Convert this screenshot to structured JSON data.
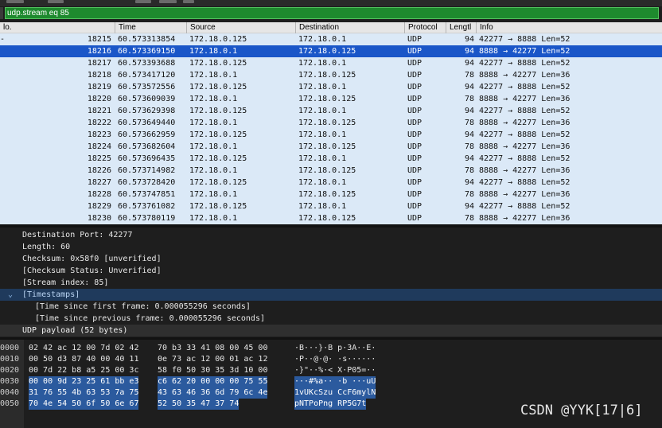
{
  "filter": {
    "value": "udp.stream eq 85"
  },
  "columns": {
    "no": "lo.",
    "time": "Time",
    "source": "Source",
    "destination": "Destination",
    "protocol": "Protocol",
    "length": "Lengtl",
    "info": "Info"
  },
  "packets": [
    {
      "mark": "-",
      "no": "18215",
      "time": "60.573313854",
      "src": "172.18.0.125",
      "dst": "172.18.0.1",
      "proto": "UDP",
      "len": "94",
      "info": "42277 → 8888 Len=52"
    },
    {
      "mark": "",
      "no": "18216",
      "time": "60.573369150",
      "src": "172.18.0.1",
      "dst": "172.18.0.125",
      "proto": "UDP",
      "len": "94",
      "info": "8888 → 42277 Len=52"
    },
    {
      "mark": "",
      "no": "18217",
      "time": "60.573393688",
      "src": "172.18.0.125",
      "dst": "172.18.0.1",
      "proto": "UDP",
      "len": "94",
      "info": "42277 → 8888 Len=52"
    },
    {
      "mark": "",
      "no": "18218",
      "time": "60.573417120",
      "src": "172.18.0.1",
      "dst": "172.18.0.125",
      "proto": "UDP",
      "len": "78",
      "info": "8888 → 42277 Len=36"
    },
    {
      "mark": "",
      "no": "18219",
      "time": "60.573572556",
      "src": "172.18.0.125",
      "dst": "172.18.0.1",
      "proto": "UDP",
      "len": "94",
      "info": "42277 → 8888 Len=52"
    },
    {
      "mark": "",
      "no": "18220",
      "time": "60.573609039",
      "src": "172.18.0.1",
      "dst": "172.18.0.125",
      "proto": "UDP",
      "len": "78",
      "info": "8888 → 42277 Len=36"
    },
    {
      "mark": "",
      "no": "18221",
      "time": "60.573629398",
      "src": "172.18.0.125",
      "dst": "172.18.0.1",
      "proto": "UDP",
      "len": "94",
      "info": "42277 → 8888 Len=52"
    },
    {
      "mark": "",
      "no": "18222",
      "time": "60.573649440",
      "src": "172.18.0.1",
      "dst": "172.18.0.125",
      "proto": "UDP",
      "len": "78",
      "info": "8888 → 42277 Len=36"
    },
    {
      "mark": "",
      "no": "18223",
      "time": "60.573662959",
      "src": "172.18.0.125",
      "dst": "172.18.0.1",
      "proto": "UDP",
      "len": "94",
      "info": "42277 → 8888 Len=52"
    },
    {
      "mark": "",
      "no": "18224",
      "time": "60.573682604",
      "src": "172.18.0.1",
      "dst": "172.18.0.125",
      "proto": "UDP",
      "len": "78",
      "info": "8888 → 42277 Len=36"
    },
    {
      "mark": "",
      "no": "18225",
      "time": "60.573696435",
      "src": "172.18.0.125",
      "dst": "172.18.0.1",
      "proto": "UDP",
      "len": "94",
      "info": "42277 → 8888 Len=52"
    },
    {
      "mark": "",
      "no": "18226",
      "time": "60.573714982",
      "src": "172.18.0.1",
      "dst": "172.18.0.125",
      "proto": "UDP",
      "len": "78",
      "info": "8888 → 42277 Len=36"
    },
    {
      "mark": "",
      "no": "18227",
      "time": "60.573728420",
      "src": "172.18.0.125",
      "dst": "172.18.0.1",
      "proto": "UDP",
      "len": "94",
      "info": "42277 → 8888 Len=52"
    },
    {
      "mark": "",
      "no": "18228",
      "time": "60.573747851",
      "src": "172.18.0.1",
      "dst": "172.18.0.125",
      "proto": "UDP",
      "len": "78",
      "info": "8888 → 42277 Len=36"
    },
    {
      "mark": "",
      "no": "18229",
      "time": "60.573761082",
      "src": "172.18.0.125",
      "dst": "172.18.0.1",
      "proto": "UDP",
      "len": "94",
      "info": "42277 → 8888 Len=52"
    },
    {
      "mark": "",
      "no": "18230",
      "time": "60.573780119",
      "src": "172.18.0.1",
      "dst": "172.18.0.125",
      "proto": "UDP",
      "len": "78",
      "info": "8888 → 42277 Len=36"
    }
  ],
  "details": [
    "Destination Port: 42277",
    "Length: 60",
    "Checksum: 0x58f0 [unverified]",
    "[Checksum Status: Unverified]",
    "[Stream index: 85]",
    "[Timestamps]",
    "[Time since first frame: 0.000055296 seconds]",
    "[Time since previous frame: 0.000055296 seconds]",
    "UDP payload (52 bytes)"
  ],
  "bytes": [
    {
      "off": "0000",
      "h1": "02 42 ac 12 00 7d 02 42",
      "h2": "70 b3 33 41 08 00 45 00",
      "asc": "·B···}·B p·3A··E·"
    },
    {
      "off": "0010",
      "h1": "00 50 d3 87 40 00 40 11",
      "h2": "0e 73 ac 12 00 01 ac 12",
      "asc": "·P··@·@· ·s······"
    },
    {
      "off": "0020",
      "h1": "00 7d 22 b8 a5 25 00 3c",
      "h2": "58 f0 50 30 35 3d 10 00",
      "asc": "·}\"··%·< X·P05=··"
    },
    {
      "off": "0030",
      "h1": "00 00 9d 23 25 61 bb e3",
      "h2": "c6 62 20 00 00 00 75 55",
      "asc": "···#%a·· ·b ···uU"
    },
    {
      "off": "0040",
      "h1": "31 76 55 4b 63 53 7a 75",
      "h2": "43 63 46 36 6d 79 6c 4e",
      "asc": "1vUKcSzu CcF6mylN"
    },
    {
      "off": "0050",
      "h1": "70 4e 54 50 6f 50 6e 67",
      "h2": "52 50 35 47 37 74",
      "asc": "pNTPoPng RP5G7t"
    }
  ],
  "watermark": "CSDN @YYK[17|6]",
  "colors": {
    "filter_bg": "#1e8a2e",
    "list_bg": "#dbe9f7",
    "selected_row": "#1a56c8",
    "payload_highlight": "#2b5a9e"
  }
}
